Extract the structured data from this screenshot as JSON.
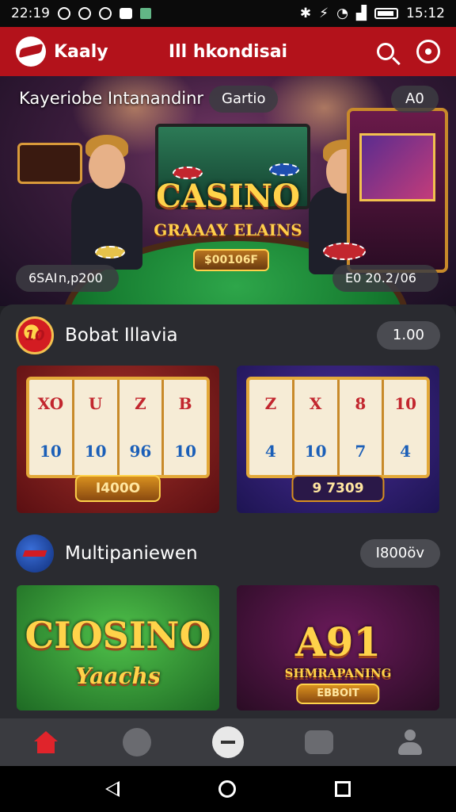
{
  "status": {
    "time": "22:19",
    "clock_right": "15:12"
  },
  "appbar": {
    "brand": "Kaaly",
    "title": "Ill hkondisai"
  },
  "hero": {
    "headline": "Kayeriobe  Intanandinr",
    "category_pill": "Gartio",
    "corner_pill": "A0",
    "casino_title": "CASINO",
    "casino_subtitle": "GRAAAY ELAINS",
    "plaque": "$00106F",
    "bottom_left": "6SAI n,p200",
    "bottom_right": "E0  20.2 / 06"
  },
  "sections": [
    {
      "title": "Bobat Illavia",
      "badge": "1.00",
      "icon_text": "10"
    },
    {
      "title": "Multipaniewen",
      "badge": "I800öv",
      "icon_text": ""
    }
  ],
  "cards": {
    "slot1": {
      "reels": [
        [
          "XO",
          "10"
        ],
        [
          "U",
          "10"
        ],
        [
          "Z",
          "96"
        ],
        [
          "B",
          "10"
        ]
      ],
      "plaque": "I400O"
    },
    "slot2": {
      "reels": [
        [
          "Z",
          "4"
        ],
        [
          "X",
          "10"
        ],
        [
          "8",
          "7"
        ],
        [
          "10",
          "4"
        ]
      ],
      "plaque": "9  7309"
    },
    "slot3": {
      "title": "CIOSINO",
      "subtitle": "Yaachs"
    },
    "slot4": {
      "title": "A91",
      "subtitle": "SHMRAPANING",
      "plaque": "EBBOIT"
    }
  },
  "colors": {
    "appbar": "#b3121b",
    "sheet": "#2a2b30",
    "gold": "#ffd34a",
    "nav_active": "#e0242b"
  },
  "icons": [
    "wifi-icon",
    "bluetooth-icon",
    "battery-icon",
    "search-icon",
    "settings-icon",
    "home-icon",
    "games-icon",
    "center-icon",
    "tv-icon",
    "user-icon",
    "back-icon",
    "home-button-icon",
    "recents-icon"
  ]
}
